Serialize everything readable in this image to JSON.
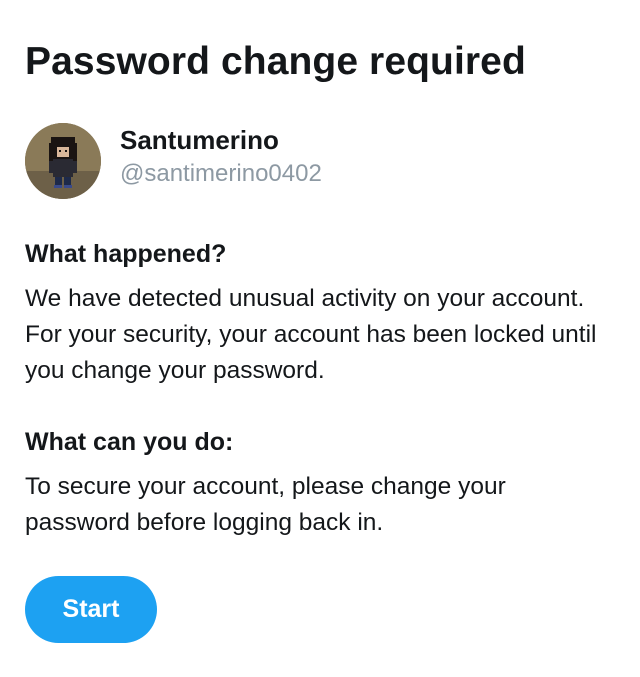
{
  "page": {
    "title": "Password change required"
  },
  "user": {
    "name": "Santumerino",
    "handle": "@santimerino0402",
    "avatar_icon": "pixel-art-character-avatar"
  },
  "sections": [
    {
      "heading": "What happened?",
      "body": "We have detected unusual activity on your account. For your security, your account has been locked until you change your password."
    },
    {
      "heading": "What can you do:",
      "body": "To secure your account, please change your password before logging back in."
    }
  ],
  "actions": {
    "start_label": "Start"
  },
  "colors": {
    "primary": "#1da1f2",
    "text": "#14171a",
    "secondary_text": "#8d99a3",
    "background": "#ffffff"
  }
}
